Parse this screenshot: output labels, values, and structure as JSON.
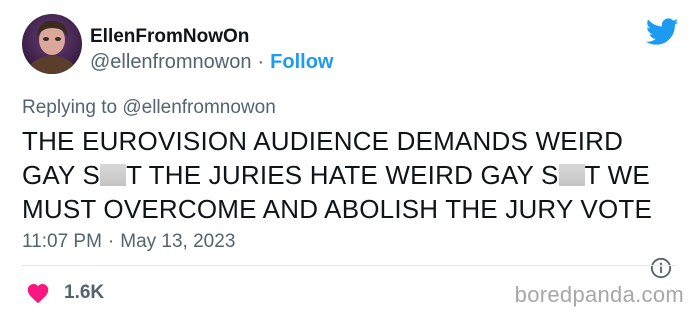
{
  "author": {
    "display_name": "EllenFromNowOn",
    "handle": "@ellenfromnowon",
    "separator": "·",
    "follow_label": "Follow"
  },
  "reply": {
    "prefix": "Replying to ",
    "handle": "@ellenfromnowon"
  },
  "tweet": {
    "part1": "THE EUROVISION AUDIENCE DEMANDS WEIRD GAY S",
    "part2": "T THE JURIES HATE WEIRD GAY S",
    "part3": "T WE MUST OVERCOME AND ABOLISH THE JURY VOTE"
  },
  "meta": {
    "time": "11:07 PM",
    "separator": "·",
    "date": "May 13, 2023"
  },
  "engagement": {
    "likes": "1.6K"
  },
  "watermark": "boredpanda.com",
  "colors": {
    "accent": "#1d9bf0",
    "heart": "#f91880",
    "muted": "#536471"
  },
  "icons": [
    "twitter-bird-icon",
    "info-icon",
    "heart-icon"
  ]
}
